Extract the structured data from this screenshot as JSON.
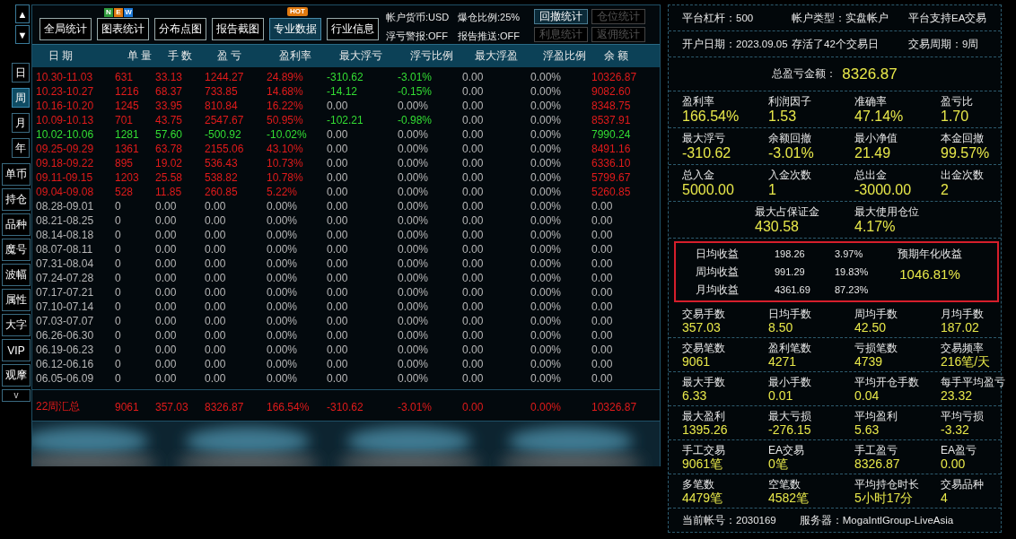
{
  "sidebar": {
    "arrows": [
      "▲",
      "▼"
    ],
    "period_buttons": [
      {
        "label": "日",
        "selected": false
      },
      {
        "label": "周",
        "selected": true
      },
      {
        "label": "月",
        "selected": false
      },
      {
        "label": "年",
        "selected": false
      }
    ],
    "tool_buttons": [
      "单币",
      "持仓",
      "品种",
      "魔号",
      "波幅",
      "属性",
      "大字",
      "VIP",
      "观摩"
    ],
    "more": "v"
  },
  "toolbar": {
    "buttons": [
      {
        "label": "全局统计",
        "selected": false
      },
      {
        "label": "图表统计",
        "selected": false,
        "badge": {
          "kind": "new",
          "letters": [
            {
              "text": "N",
              "color": "#2f9a3c"
            },
            {
              "text": "E",
              "color": "#e0790f"
            },
            {
              "text": "W",
              "color": "#1c78d6"
            }
          ]
        }
      },
      {
        "label": "分布点图",
        "selected": false
      },
      {
        "label": "报告截图",
        "selected": false
      },
      {
        "label": "专业数据",
        "selected": true,
        "badge": {
          "kind": "hot",
          "text": "HOT"
        }
      },
      {
        "label": "行业信息",
        "selected": false
      }
    ],
    "info": [
      "帐户货币:USD",
      "爆仓比例:25%",
      "浮亏警报:OFF",
      "报告推送:OFF"
    ],
    "stat_buttons": [
      {
        "label": "回撤统计",
        "disabled": false
      },
      {
        "label": "仓位统计",
        "disabled": true
      },
      {
        "label": "利息统计",
        "disabled": true
      },
      {
        "label": "返佣统计",
        "disabled": true
      }
    ]
  },
  "table": {
    "columns": [
      "日 期",
      "单 量",
      "手 数",
      "盈 亏",
      "盈利率",
      "最大浮亏",
      "浮亏比例",
      "最大浮盈",
      "浮盈比例",
      "余 额"
    ],
    "rows": [
      {
        "color": "#e21b1b",
        "float": {
          "color": "#33dd33"
        },
        "cells": [
          "10.30-11.03",
          "631",
          "33.13",
          "1244.27",
          "24.89%",
          "-310.62",
          "-3.01%",
          "0.00",
          "0.00%",
          "10326.87"
        ]
      },
      {
        "color": "#e21b1b",
        "float": {
          "color": "#33dd33"
        },
        "cells": [
          "10.23-10.27",
          "1216",
          "68.37",
          "733.85",
          "14.68%",
          "-14.12",
          "-0.15%",
          "0.00",
          "0.00%",
          "9082.60"
        ]
      },
      {
        "color": "#e21b1b",
        "float": {
          "color": "#b8b8b8"
        },
        "cells": [
          "10.16-10.20",
          "1245",
          "33.95",
          "810.84",
          "16.22%",
          "0.00",
          "0.00%",
          "0.00",
          "0.00%",
          "8348.75"
        ]
      },
      {
        "color": "#e21b1b",
        "float": {
          "color": "#33dd33"
        },
        "cells": [
          "10.09-10.13",
          "701",
          "43.75",
          "2547.67",
          "50.95%",
          "-102.21",
          "-0.98%",
          "0.00",
          "0.00%",
          "8537.91"
        ]
      },
      {
        "color": "#33dd33",
        "float": {
          "color": "#b8b8b8"
        },
        "cells": [
          "10.02-10.06",
          "1281",
          "57.60",
          "-500.92",
          "-10.02%",
          "0.00",
          "0.00%",
          "0.00",
          "0.00%",
          "7990.24"
        ]
      },
      {
        "color": "#e21b1b",
        "float": {
          "color": "#b8b8b8"
        },
        "cells": [
          "09.25-09.29",
          "1361",
          "63.78",
          "2155.06",
          "43.10%",
          "0.00",
          "0.00%",
          "0.00",
          "0.00%",
          "8491.16"
        ]
      },
      {
        "color": "#e21b1b",
        "float": {
          "color": "#b8b8b8"
        },
        "cells": [
          "09.18-09.22",
          "895",
          "19.02",
          "536.43",
          "10.73%",
          "0.00",
          "0.00%",
          "0.00",
          "0.00%",
          "6336.10"
        ]
      },
      {
        "color": "#e21b1b",
        "float": {
          "color": "#b8b8b8"
        },
        "cells": [
          "09.11-09.15",
          "1203",
          "25.58",
          "538.82",
          "10.78%",
          "0.00",
          "0.00%",
          "0.00",
          "0.00%",
          "5799.67"
        ]
      },
      {
        "color": "#e21b1b",
        "float": {
          "color": "#b8b8b8"
        },
        "cells": [
          "09.04-09.08",
          "528",
          "11.85",
          "260.85",
          "5.22%",
          "0.00",
          "0.00%",
          "0.00",
          "0.00%",
          "5260.85"
        ]
      },
      {
        "color": "#b8b8b8",
        "float": {
          "color": "#b8b8b8"
        },
        "cells": [
          "08.28-09.01",
          "0",
          "0.00",
          "0.00",
          "0.00%",
          "0.00",
          "0.00%",
          "0.00",
          "0.00%",
          "0.00"
        ]
      },
      {
        "color": "#b8b8b8",
        "float": {
          "color": "#b8b8b8"
        },
        "cells": [
          "08.21-08.25",
          "0",
          "0.00",
          "0.00",
          "0.00%",
          "0.00",
          "0.00%",
          "0.00",
          "0.00%",
          "0.00"
        ]
      },
      {
        "color": "#b8b8b8",
        "float": {
          "color": "#b8b8b8"
        },
        "cells": [
          "08.14-08.18",
          "0",
          "0.00",
          "0.00",
          "0.00%",
          "0.00",
          "0.00%",
          "0.00",
          "0.00%",
          "0.00"
        ]
      },
      {
        "color": "#b8b8b8",
        "float": {
          "color": "#b8b8b8"
        },
        "cells": [
          "08.07-08.11",
          "0",
          "0.00",
          "0.00",
          "0.00%",
          "0.00",
          "0.00%",
          "0.00",
          "0.00%",
          "0.00"
        ]
      },
      {
        "color": "#b8b8b8",
        "float": {
          "color": "#b8b8b8"
        },
        "cells": [
          "07.31-08.04",
          "0",
          "0.00",
          "0.00",
          "0.00%",
          "0.00",
          "0.00%",
          "0.00",
          "0.00%",
          "0.00"
        ]
      },
      {
        "color": "#b8b8b8",
        "float": {
          "color": "#b8b8b8"
        },
        "cells": [
          "07.24-07.28",
          "0",
          "0.00",
          "0.00",
          "0.00%",
          "0.00",
          "0.00%",
          "0.00",
          "0.00%",
          "0.00"
        ]
      },
      {
        "color": "#b8b8b8",
        "float": {
          "color": "#b8b8b8"
        },
        "cells": [
          "07.17-07.21",
          "0",
          "0.00",
          "0.00",
          "0.00%",
          "0.00",
          "0.00%",
          "0.00",
          "0.00%",
          "0.00"
        ]
      },
      {
        "color": "#b8b8b8",
        "float": {
          "color": "#b8b8b8"
        },
        "cells": [
          "07.10-07.14",
          "0",
          "0.00",
          "0.00",
          "0.00%",
          "0.00",
          "0.00%",
          "0.00",
          "0.00%",
          "0.00"
        ]
      },
      {
        "color": "#b8b8b8",
        "float": {
          "color": "#b8b8b8"
        },
        "cells": [
          "07.03-07.07",
          "0",
          "0.00",
          "0.00",
          "0.00%",
          "0.00",
          "0.00%",
          "0.00",
          "0.00%",
          "0.00"
        ]
      },
      {
        "color": "#b8b8b8",
        "float": {
          "color": "#b8b8b8"
        },
        "cells": [
          "06.26-06.30",
          "0",
          "0.00",
          "0.00",
          "0.00%",
          "0.00",
          "0.00%",
          "0.00",
          "0.00%",
          "0.00"
        ]
      },
      {
        "color": "#b8b8b8",
        "float": {
          "color": "#b8b8b8"
        },
        "cells": [
          "06.19-06.23",
          "0",
          "0.00",
          "0.00",
          "0.00%",
          "0.00",
          "0.00%",
          "0.00",
          "0.00%",
          "0.00"
        ]
      },
      {
        "color": "#b8b8b8",
        "float": {
          "color": "#b8b8b8"
        },
        "cells": [
          "06.12-06.16",
          "0",
          "0.00",
          "0.00",
          "0.00%",
          "0.00",
          "0.00%",
          "0.00",
          "0.00%",
          "0.00"
        ]
      },
      {
        "color": "#b8b8b8",
        "float": {
          "color": "#b8b8b8"
        },
        "cells": [
          "06.05-06.09",
          "0",
          "0.00",
          "0.00",
          "0.00%",
          "0.00",
          "0.00%",
          "0.00",
          "0.00%",
          "0.00"
        ]
      }
    ],
    "summary": {
      "color": "#e21b1b",
      "cells": [
        "22周汇总",
        "9061",
        "357.03",
        "8326.87",
        "166.54%",
        "-310.62",
        "-3.01%",
        "0.00",
        "0.00%",
        "10326.87"
      ]
    }
  },
  "account": {
    "info_rows": [
      [
        "平台杠杆：500",
        "帐户类型：实盘帐户",
        "平台支持EA交易"
      ],
      [
        "开户日期：2023.09.05",
        "存活了42个交易日",
        "交易周期：9周"
      ]
    ],
    "total_label": "总盈亏金额：",
    "total_value": "8326.87",
    "groups": [
      {
        "stats": [
          {
            "label": "盈利率",
            "value": "166.54%"
          },
          {
            "label": "利润因子",
            "value": "1.53"
          },
          {
            "label": "准确率",
            "value": "47.14%"
          },
          {
            "label": "盈亏比",
            "value": "1.70"
          }
        ]
      },
      {
        "stats": [
          {
            "label": "最大浮亏",
            "value": "-310.62"
          },
          {
            "label": "余额回撤",
            "value": "-3.01%"
          },
          {
            "label": "最小净值",
            "value": "21.49"
          },
          {
            "label": "本金回撤",
            "value": "99.57%"
          }
        ]
      },
      {
        "stats": [
          {
            "label": "总入金",
            "value": "5000.00"
          },
          {
            "label": "入金次数",
            "value": "1"
          },
          {
            "label": "总出金",
            "value": "-3000.00"
          },
          {
            "label": "出金次数",
            "value": "2"
          }
        ]
      },
      {
        "stats": [
          {
            "label": "最大占保证金",
            "value": "430.58"
          },
          {
            "label": "最大使用仓位",
            "value": "4.17%"
          }
        ]
      }
    ],
    "returns": {
      "rows": [
        {
          "label": "日均收益",
          "amount": "198.26",
          "percent": "3.97%"
        },
        {
          "label": "周均收益",
          "amount": "991.29",
          "percent": "19.83%"
        },
        {
          "label": "月均收益",
          "amount": "4361.69",
          "percent": "87.23%"
        }
      ],
      "annual_label": "预期年化收益",
      "annual_value": "1046.81%"
    },
    "groups2": [
      {
        "stats": [
          {
            "label": "交易手数",
            "value": "357.03"
          },
          {
            "label": "日均手数",
            "value": "8.50"
          },
          {
            "label": "周均手数",
            "value": "42.50"
          },
          {
            "label": "月均手数",
            "value": "187.02"
          }
        ]
      },
      {
        "stats": [
          {
            "label": "交易笔数",
            "value": "9061"
          },
          {
            "label": "盈利笔数",
            "value": "4271"
          },
          {
            "label": "亏损笔数",
            "value": "4739"
          },
          {
            "label": "交易频率",
            "value": "216笔/天"
          }
        ]
      },
      {
        "stats": [
          {
            "label": "最大手数",
            "value": "6.33"
          },
          {
            "label": "最小手数",
            "value": "0.01"
          },
          {
            "label": "平均开仓手数",
            "value": "0.04"
          },
          {
            "label": "每手平均盈亏",
            "value": "23.32"
          }
        ]
      },
      {
        "stats": [
          {
            "label": "最大盈利",
            "value": "1395.26"
          },
          {
            "label": "最大亏损",
            "value": "-276.15"
          },
          {
            "label": "平均盈利",
            "value": "5.63"
          },
          {
            "label": "平均亏损",
            "value": "-3.32"
          }
        ]
      },
      {
        "stats": [
          {
            "label": "手工交易",
            "value": "9061笔"
          },
          {
            "label": "EA交易",
            "value": "0笔"
          },
          {
            "label": "手工盈亏",
            "value": "8326.87"
          },
          {
            "label": "EA盈亏",
            "value": "0.00"
          }
        ]
      },
      {
        "stats": [
          {
            "label": "多笔数",
            "value": "4479笔"
          },
          {
            "label": "空笔数",
            "value": "4582笔"
          },
          {
            "label": "平均持仓时长",
            "value": "5小时17分"
          },
          {
            "label": "交易品种",
            "value": "4"
          }
        ]
      }
    ],
    "footer": [
      "当前帐号：2030169",
      "服务器：MogaIntlGroup-LiveAsia"
    ]
  }
}
